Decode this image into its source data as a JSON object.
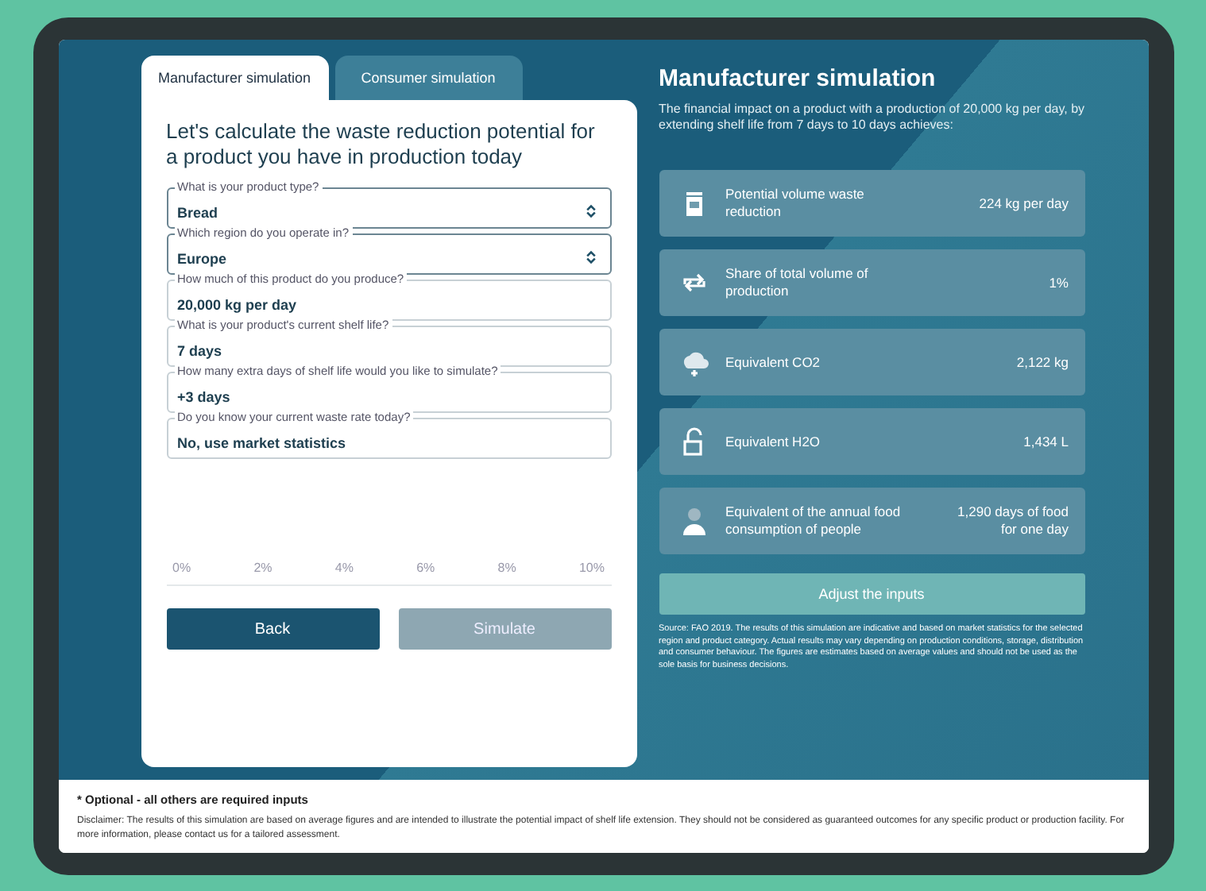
{
  "tabs": [
    {
      "label": "Manufacturer simulation",
      "selected": true
    },
    {
      "label": "Consumer simulation",
      "selected": false
    }
  ],
  "form": {
    "heading": "Let's calculate the waste reduction potential for a product you have in production today",
    "fields": [
      {
        "kind": "select",
        "label": "What is your product type?",
        "value": "Bread"
      },
      {
        "kind": "select",
        "label": "Which region do you operate in?",
        "value": "Europe"
      },
      {
        "kind": "text",
        "label": "How much of this product do you produce?",
        "value": "20,000 kg per day"
      },
      {
        "kind": "text",
        "label": "What is your product's current shelf life?",
        "value": "7 days"
      },
      {
        "kind": "text",
        "label": "How many extra days of shelf life would you like to simulate?",
        "value": "+3 days"
      },
      {
        "kind": "text",
        "label": "Do you know your current waste rate today?",
        "value": "No, use market statistics"
      }
    ],
    "scale_ticks": [
      "0%",
      "2%",
      "4%",
      "6%",
      "8%",
      "10%"
    ],
    "buttons": [
      {
        "label": "Back",
        "disabled": false
      },
      {
        "label": "Simulate",
        "disabled": true
      }
    ]
  },
  "results": {
    "title": "Manufacturer simulation",
    "intro": "The financial impact on a product with a production of 20,000 kg per day, by extending shelf life from 7 days to 10 days achieves:",
    "cards": [
      {
        "kind": "bin",
        "label": "Potential volume waste reduction",
        "value": "224 kg per day"
      },
      {
        "kind": "cycle",
        "label": "Share of total volume of production",
        "value": "1%"
      },
      {
        "kind": "cloud",
        "label": "Equivalent CO2",
        "value": "2,122 kg"
      },
      {
        "kind": "lock",
        "label": "Equivalent H2O",
        "value": "1,434 L"
      },
      {
        "kind": "person",
        "label": "Equivalent of the annual food consumption of people",
        "value": "1,290 days of food for one day"
      }
    ],
    "action": "Adjust the inputs",
    "disclaimer": "Source: FAO 2019. The results of this simulation are indicative and based on market statistics for the selected region and product category. Actual results may vary depending on production conditions, storage, distribution and consumer behaviour. The figures are estimates based on average values and should not be used as the sole basis for business decisions."
  },
  "footer": {
    "note": "* Optional - all others are required inputs",
    "text": "Disclaimer: The results of this simulation are based on average figures and are intended to illustrate the potential impact of shelf life extension. They should not be considered as guaranteed outcomes for any specific product or production facility. For more information, please contact us for a tailored assessment."
  }
}
